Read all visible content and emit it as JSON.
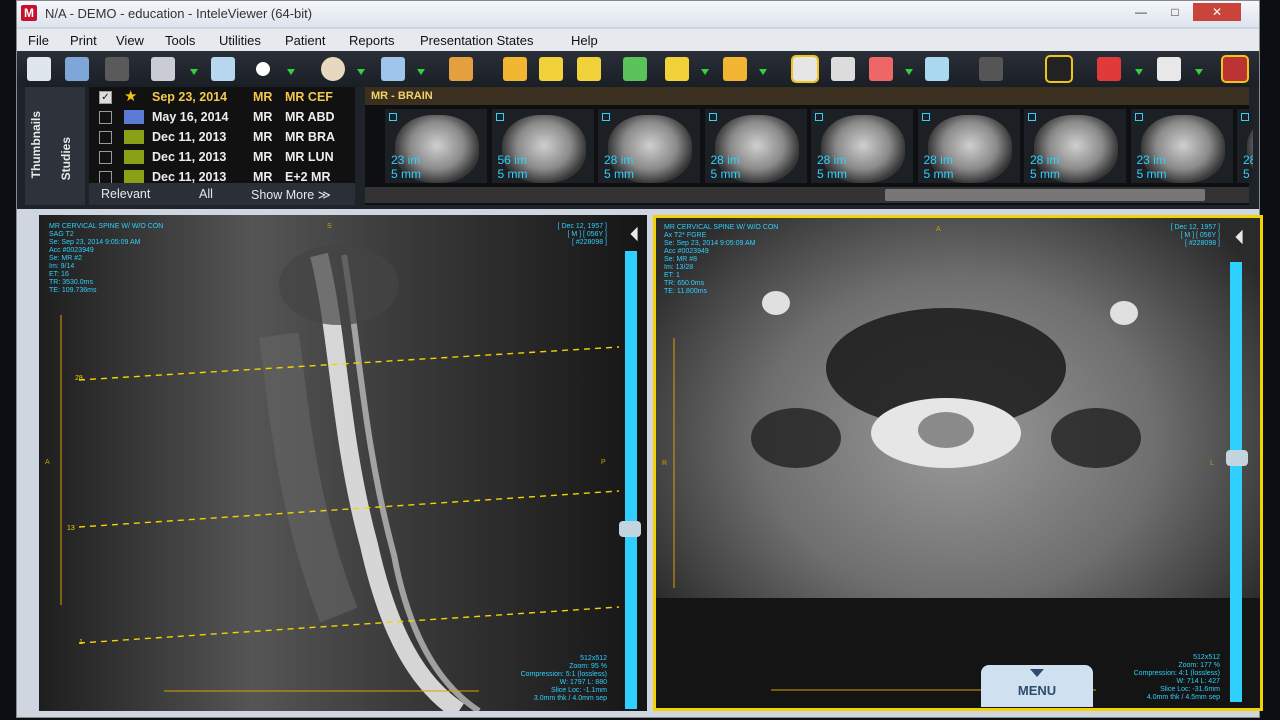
{
  "window": {
    "title": "N/A - DEMO - education - InteleViewer (64-bit)",
    "app_icon": "M"
  },
  "menu": [
    "File",
    "Print",
    "View",
    "Tools",
    "Utilities",
    "Patient",
    "Reports",
    "Presentation States",
    "Help"
  ],
  "side_tabs": {
    "thumbnails": "Thumbnails",
    "studies": "Studies"
  },
  "studies": [
    {
      "date": "Sep 23, 2014",
      "modality": "MR",
      "desc": "MR CEF",
      "checked": true,
      "swatch": "#f1c40f",
      "star": true
    },
    {
      "date": "May 16, 2014",
      "modality": "MR",
      "desc": "MR ABD",
      "checked": false,
      "swatch": "#5b7bd5"
    },
    {
      "date": "Dec 11, 2013",
      "modality": "MR",
      "desc": "MR BRA",
      "checked": false,
      "swatch": "#8aa117"
    },
    {
      "date": "Dec 11, 2013",
      "modality": "MR",
      "desc": "MR LUN",
      "checked": false,
      "swatch": "#8aa117"
    },
    {
      "date": "Dec 11, 2013",
      "modality": "MR",
      "desc": "E+2 MR",
      "checked": false,
      "swatch": "#8aa117"
    }
  ],
  "studies_footer": {
    "relevant": "Relevant",
    "all": "All",
    "show_more": "Show More ≫"
  },
  "thumb_header": "MR - BRAIN",
  "thumbnails": [
    {
      "count": "23 im",
      "thick": "5 mm"
    },
    {
      "count": "56 im",
      "thick": "5 mm"
    },
    {
      "count": "28 im",
      "thick": "5 mm"
    },
    {
      "count": "28 im",
      "thick": "5 mm"
    },
    {
      "count": "28 im",
      "thick": "5 mm"
    },
    {
      "count": "28 im",
      "thick": "5 mm"
    },
    {
      "count": "28 im",
      "thick": "5 mm"
    },
    {
      "count": "23 im",
      "thick": "5 mm"
    },
    {
      "count": "28",
      "thick": "5"
    }
  ],
  "left_view": {
    "top_left": [
      "MR CERVICAL SPINE W/ W/O CON",
      "SAG T2",
      "Se: Sep 23, 2014 9:05:09 AM",
      "Acc #0023949",
      "Se: MR #2",
      "Im: 9/14",
      "ET: 16",
      "TR: 3530.0ms",
      "TE: 109.736ms"
    ],
    "top_right": [
      "[ Dec 12, 1957 ]",
      "[ M ] [ 056Y ]",
      "[ #228098 ]"
    ],
    "bottom_right": [
      "512x512",
      "Zoom: 95 %",
      "Compression: 5:1 (lossless)",
      "W: 1797 L: 880",
      "Slice Loc: -1.1mm",
      "3.0mm thk / 4.0mm sep"
    ],
    "orient_top": "S",
    "orient_left": "A",
    "orient_right": "P",
    "line_labels": [
      "28",
      "13",
      "1"
    ]
  },
  "right_view": {
    "top_left": [
      "MR CERVICAL SPINE W/ W/O CON",
      "Ax T2* FGRE",
      "Se: Sep 23, 2014 9:05:09 AM",
      "Acc #0023949",
      "Se: MR #8",
      "Im: 13/28",
      "ET: 1",
      "TR: 650.0ms",
      "TE: 11.800ms"
    ],
    "top_right": [
      "[ Dec 12, 1957 ]",
      "[ M ] [ 056Y ]",
      "[ #228098 ]"
    ],
    "bottom_right": [
      "512x512",
      "Zoom: 177 %",
      "Compression: 4:1 (lossless)",
      "W: 714 L: 427",
      "Slice Loc: -31.6mm",
      "4.0mm thk / 4.5mm sep"
    ],
    "orient_top": "A",
    "orient_left": "R",
    "orient_right": "L"
  },
  "menu_button": "MENU"
}
